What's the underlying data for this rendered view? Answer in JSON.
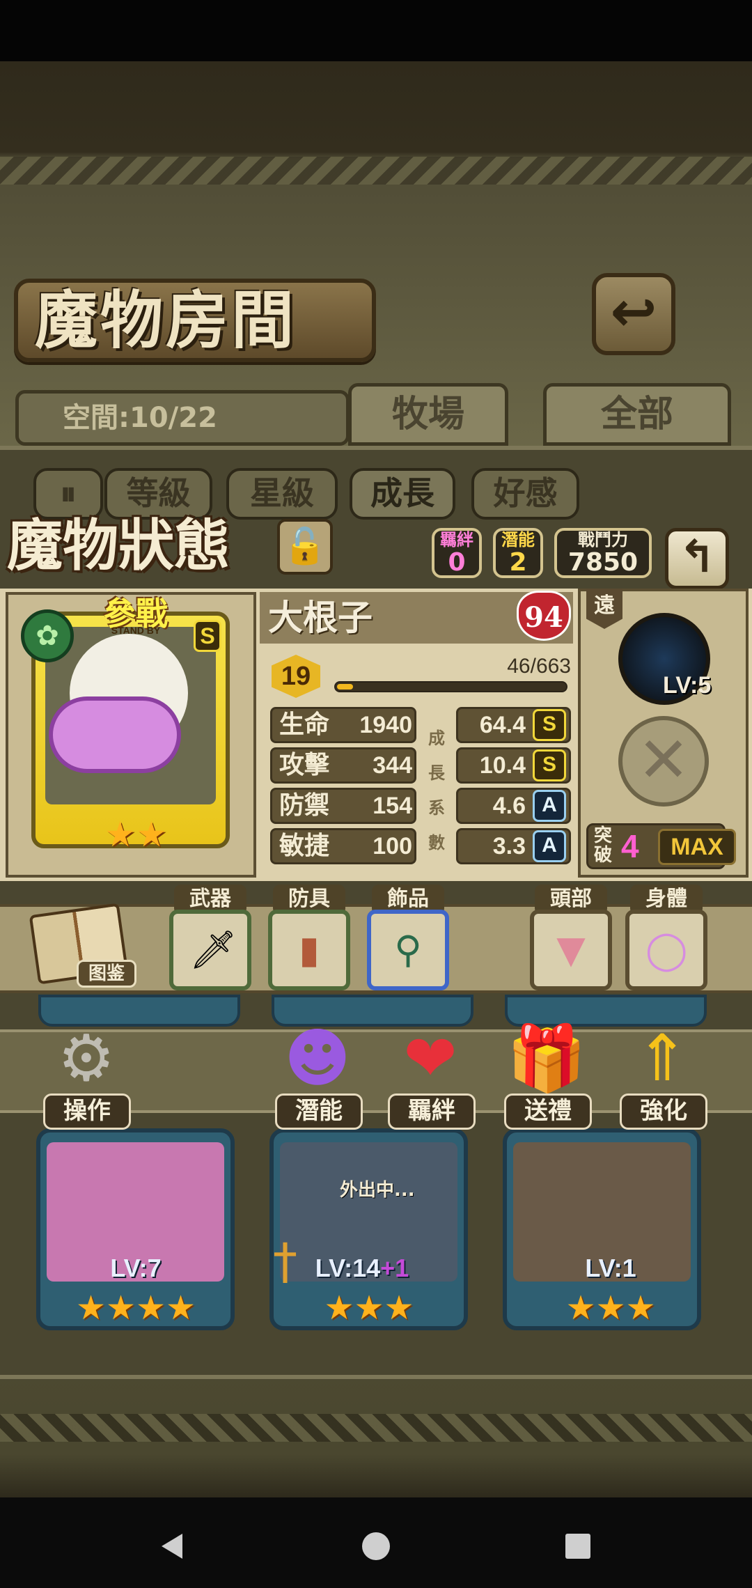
{
  "header": {
    "title": "魔物房間",
    "back_icon": "return-arrow-icon"
  },
  "space": {
    "label": "空間:10/22"
  },
  "tabs": [
    {
      "label": "牧場"
    },
    {
      "label": "全部"
    }
  ],
  "filters": {
    "pause_icon": "pause-icon",
    "items": [
      "等級",
      "星級",
      "成長",
      "好感"
    ]
  },
  "status": {
    "title": "魔物狀態",
    "bond": {
      "label": "羈絆",
      "value": "0"
    },
    "potential": {
      "label": "潛能",
      "value": "2"
    },
    "power": {
      "label": "戰鬥力",
      "value": "7850"
    }
  },
  "card": {
    "badge": "參戰",
    "standby": "STAND BY",
    "rank": "S"
  },
  "monster": {
    "name": "大根子",
    "affection": "94",
    "level": "19",
    "exp_text": "46/663",
    "exp_progress": 0.069,
    "stats": [
      {
        "name": "生命",
        "value": "1940",
        "growth": "64.4",
        "grade": "S"
      },
      {
        "name": "攻擊",
        "value": "344",
        "growth": "10.4",
        "grade": "S"
      },
      {
        "name": "防禦",
        "value": "154",
        "growth": "4.6",
        "grade": "A"
      },
      {
        "name": "敏捷",
        "value": "100",
        "growth": "3.3",
        "grade": "A"
      }
    ],
    "growth_vertical": [
      "成",
      "長",
      "系",
      "數"
    ]
  },
  "skill": {
    "range": "遠",
    "level": "LV:5"
  },
  "breakthrough": {
    "label": "突破",
    "value": "4",
    "max_label": "MAX"
  },
  "equipment": {
    "book_label": "图鉴",
    "slots": [
      {
        "label": "武器"
      },
      {
        "label": "防具"
      },
      {
        "label": "飾品"
      },
      {
        "label": "頭部"
      },
      {
        "label": "身體"
      }
    ]
  },
  "actions": [
    {
      "label": "操作"
    },
    {
      "label": "潛能"
    },
    {
      "label": "羈絆"
    },
    {
      "label": "送禮"
    },
    {
      "label": "強化"
    }
  ],
  "roster": [
    {
      "level": "LV:7"
    },
    {
      "level": "LV:14",
      "bonus": "+1",
      "status": "外出中..."
    },
    {
      "level": "LV:1"
    }
  ],
  "colors": {
    "accent_gold": "#f2d83a",
    "grade_s": "#f2d83a",
    "grade_a": "#9ad0f0",
    "break_pink": "#ff5fd0"
  }
}
